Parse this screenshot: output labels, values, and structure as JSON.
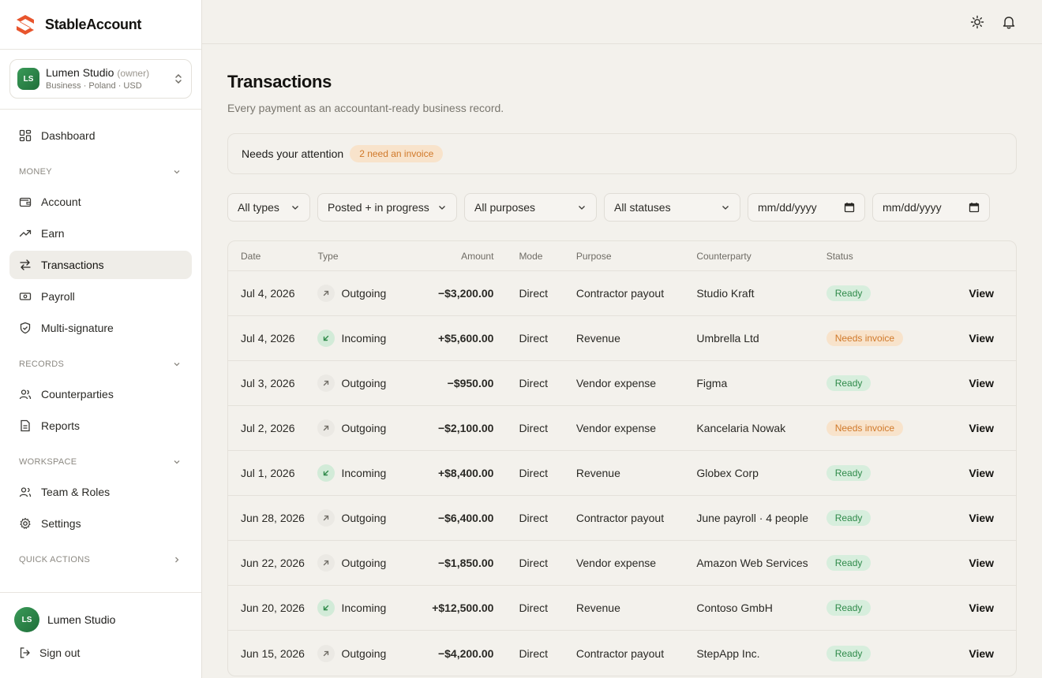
{
  "brand": {
    "name": "StableAccount"
  },
  "org": {
    "initials": "LS",
    "name": "Lumen Studio",
    "role": "(owner)",
    "details": "Business · Poland · USD"
  },
  "nav": {
    "dashboard": "Dashboard",
    "money_section": "MONEY",
    "account": "Account",
    "earn": "Earn",
    "transactions": "Transactions",
    "payroll": "Payroll",
    "multisig": "Multi-signature",
    "records_section": "RECORDS",
    "counterparties": "Counterparties",
    "reports": "Reports",
    "workspace_section": "WORKSPACE",
    "team": "Team & Roles",
    "settings": "Settings",
    "quick_section": "QUICK ACTIONS"
  },
  "user": {
    "initials": "LS",
    "name": "Lumen Studio",
    "signout": "Sign out"
  },
  "page": {
    "title": "Transactions",
    "subtitle": "Every payment as an accountant-ready business record.",
    "attention_label": "Needs your attention",
    "attention_badge": "2 need an invoice"
  },
  "filters": {
    "type": "All types",
    "state": "Posted + in progress",
    "purpose": "All purposes",
    "status": "All statuses",
    "date_from": "mm/dd/yyyy",
    "date_to": "mm/dd/yyyy"
  },
  "table": {
    "headers": {
      "date": "Date",
      "type": "Type",
      "amount": "Amount",
      "mode": "Mode",
      "purpose": "Purpose",
      "counterparty": "Counterparty",
      "status": "Status"
    },
    "view_label": "View",
    "rows": [
      {
        "date": "Jul 4, 2026",
        "type": "Outgoing",
        "dir": "out",
        "amount": "−$3,200.00",
        "mode": "Direct",
        "purpose": "Contractor payout",
        "counterparty": "Studio Kraft",
        "status": "Ready",
        "status_kind": "ready"
      },
      {
        "date": "Jul 4, 2026",
        "type": "Incoming",
        "dir": "in",
        "amount": "+$5,600.00",
        "mode": "Direct",
        "purpose": "Revenue",
        "counterparty": "Umbrella Ltd",
        "status": "Needs invoice",
        "status_kind": "warn"
      },
      {
        "date": "Jul 3, 2026",
        "type": "Outgoing",
        "dir": "out",
        "amount": "−$950.00",
        "mode": "Direct",
        "purpose": "Vendor expense",
        "counterparty": "Figma",
        "status": "Ready",
        "status_kind": "ready"
      },
      {
        "date": "Jul 2, 2026",
        "type": "Outgoing",
        "dir": "out",
        "amount": "−$2,100.00",
        "mode": "Direct",
        "purpose": "Vendor expense",
        "counterparty": "Kancelaria Nowak",
        "status": "Needs invoice",
        "status_kind": "warn"
      },
      {
        "date": "Jul 1, 2026",
        "type": "Incoming",
        "dir": "in",
        "amount": "+$8,400.00",
        "mode": "Direct",
        "purpose": "Revenue",
        "counterparty": "Globex Corp",
        "status": "Ready",
        "status_kind": "ready"
      },
      {
        "date": "Jun 28, 2026",
        "type": "Outgoing",
        "dir": "out",
        "amount": "−$6,400.00",
        "mode": "Direct",
        "purpose": "Contractor payout",
        "counterparty": "June payroll · 4 people",
        "status": "Ready",
        "status_kind": "ready"
      },
      {
        "date": "Jun 22, 2026",
        "type": "Outgoing",
        "dir": "out",
        "amount": "−$1,850.00",
        "mode": "Direct",
        "purpose": "Vendor expense",
        "counterparty": "Amazon Web Services",
        "status": "Ready",
        "status_kind": "ready"
      },
      {
        "date": "Jun 20, 2026",
        "type": "Incoming",
        "dir": "in",
        "amount": "+$12,500.00",
        "mode": "Direct",
        "purpose": "Revenue",
        "counterparty": "Contoso GmbH",
        "status": "Ready",
        "status_kind": "ready"
      },
      {
        "date": "Jun 15, 2026",
        "type": "Outgoing",
        "dir": "out",
        "amount": "−$4,200.00",
        "mode": "Direct",
        "purpose": "Contractor payout",
        "counterparty": "StepApp Inc.",
        "status": "Ready",
        "status_kind": "ready"
      }
    ]
  },
  "colors": {
    "accent": "#e8552d",
    "ready_bg": "#d7eedd",
    "ready_fg": "#2f8a4a",
    "warn_bg": "#f8e3cb",
    "warn_fg": "#d0792a",
    "incoming_icon": "#3a9a58"
  },
  "icons": {
    "brand": "stableaccount-logo-icon",
    "dashboard": "grid-icon",
    "account": "wallet-icon",
    "earn": "trending-up-icon",
    "transactions": "arrows-swap-icon",
    "payroll": "banknote-icon",
    "multisig": "shield-icon",
    "counterparties": "users-icon",
    "reports": "file-text-icon",
    "team": "user-group-icon",
    "settings": "gear-icon",
    "signout": "log-out-icon",
    "theme": "sun-icon",
    "notifications": "bell-icon"
  }
}
